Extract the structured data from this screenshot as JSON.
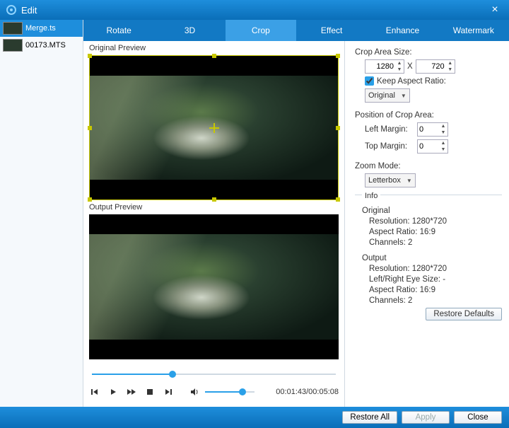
{
  "title": "Edit",
  "sidebar": {
    "items": [
      {
        "label": "Merge.ts",
        "selected": true
      },
      {
        "label": "00173.MTS",
        "selected": false
      }
    ]
  },
  "tabs": [
    "Rotate",
    "3D",
    "Crop",
    "Effect",
    "Enhance",
    "Watermark"
  ],
  "active_tab": 2,
  "preview": {
    "original_label": "Original Preview",
    "output_label": "Output Preview",
    "time": "00:01:43/00:05:08"
  },
  "crop": {
    "size_label": "Crop Area Size:",
    "width": "1280",
    "height": "720",
    "x_label": "X",
    "keep_aspect_label": "Keep Aspect Ratio:",
    "keep_aspect_checked": true,
    "aspect_value": "Original",
    "position_label": "Position of Crop Area:",
    "left_label": "Left Margin:",
    "left_value": "0",
    "top_label": "Top Margin:",
    "top_value": "0",
    "zoom_label": "Zoom Mode:",
    "zoom_value": "Letterbox"
  },
  "info": {
    "header": "Info",
    "original_label": "Original",
    "original_resolution_label": "Resolution:",
    "original_resolution": "1280*720",
    "original_aspect_label": "Aspect Ratio:",
    "original_aspect": "16:9",
    "original_channels_label": "Channels:",
    "original_channels": "2",
    "output_label": "Output",
    "output_resolution_label": "Resolution:",
    "output_resolution": "1280*720",
    "output_eye_label": "Left/Right Eye Size:",
    "output_eye": "-",
    "output_aspect_label": "Aspect Ratio:",
    "output_aspect": "16:9",
    "output_channels_label": "Channels:",
    "output_channels": "2"
  },
  "buttons": {
    "restore_defaults": "Restore Defaults",
    "restore_all": "Restore All",
    "apply": "Apply",
    "close": "Close"
  }
}
